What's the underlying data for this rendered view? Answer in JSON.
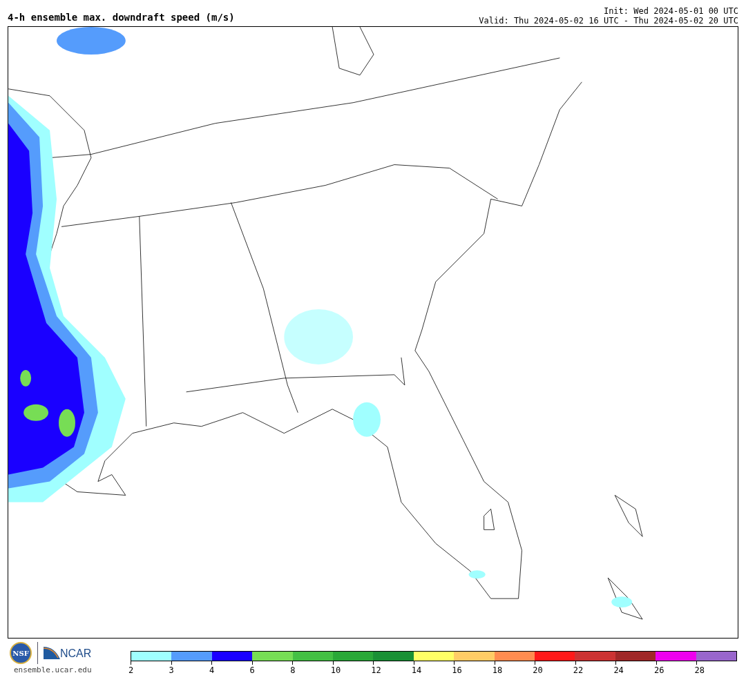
{
  "title": "4-h ensemble max. downdraft speed (m/s)",
  "init": "Init: Wed 2024-05-01 00 UTC",
  "valid": "Valid: Thu 2024-05-02 16 UTC - Thu 2024-05-02 20 UTC",
  "logos": {
    "nsf": "NSF",
    "ncar": "NCAR"
  },
  "website": "ensemble.ucar.edu",
  "colorbar": [
    {
      "label": "2",
      "color": "#a0ffff"
    },
    {
      "label": "3",
      "color": "#559cfc"
    },
    {
      "label": "4",
      "color": "#1a00ff"
    },
    {
      "label": "6",
      "color": "#77dd55"
    },
    {
      "label": "8",
      "color": "#44c044"
    },
    {
      "label": "10",
      "color": "#2aa838"
    },
    {
      "label": "12",
      "color": "#1a9035"
    },
    {
      "label": "14",
      "color": "#ffff66"
    },
    {
      "label": "16",
      "color": "#ffcc66"
    },
    {
      "label": "18",
      "color": "#ff8c50"
    },
    {
      "label": "20",
      "color": "#ff1a1a"
    },
    {
      "label": "22",
      "color": "#cc3333"
    },
    {
      "label": "24",
      "color": "#a02828"
    },
    {
      "label": "26",
      "color": "#ee00ee"
    },
    {
      "label": "28",
      "color": "#9966cc"
    }
  ]
}
